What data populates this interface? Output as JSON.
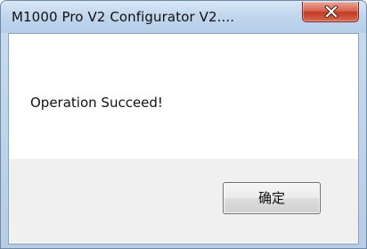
{
  "window": {
    "title": "M1000 Pro V2 Configurator V2...."
  },
  "dialog": {
    "message": "Operation Succeed!",
    "ok_label": "确定"
  },
  "icons": {
    "close": "close-icon"
  },
  "colors": {
    "close_button": "#c94a32",
    "titlebar": "#c2d7ee",
    "button_area": "#f0f0f0"
  }
}
